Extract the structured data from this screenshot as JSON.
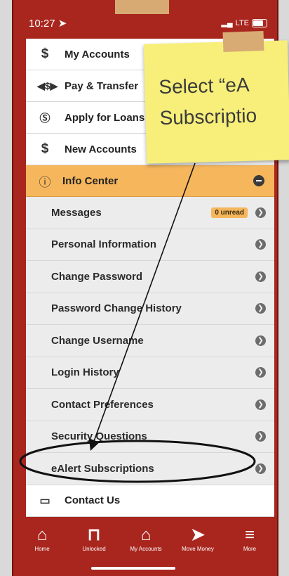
{
  "status": {
    "time": "10:27",
    "network": "LTE"
  },
  "menu": {
    "my_accounts": "My Accounts",
    "pay_transfer": "Pay & Transfer",
    "apply_loans": "Apply for Loans",
    "new_accounts": "New Accounts",
    "info_center": "Info Center",
    "contact_us": "Contact Us"
  },
  "info_items": [
    {
      "label": "Messages",
      "badge": "0 unread"
    },
    {
      "label": "Personal Information"
    },
    {
      "label": "Change Password"
    },
    {
      "label": "Password Change History"
    },
    {
      "label": "Change Username"
    },
    {
      "label": "Login History"
    },
    {
      "label": "Contact Preferences"
    },
    {
      "label": "Security Questions"
    },
    {
      "label": "eAlert Subscriptions"
    }
  ],
  "tabs": {
    "home": "Home",
    "unlocked": "Unlocked",
    "my_accounts": "My Accounts",
    "move_money": "Move Money",
    "more": "More"
  },
  "note": {
    "line1": "Select “eA",
    "line2": "Subscriptio"
  },
  "colors": {
    "brand": "#a8261e",
    "accent": "#f6b65c",
    "note": "#f7ef7a"
  }
}
